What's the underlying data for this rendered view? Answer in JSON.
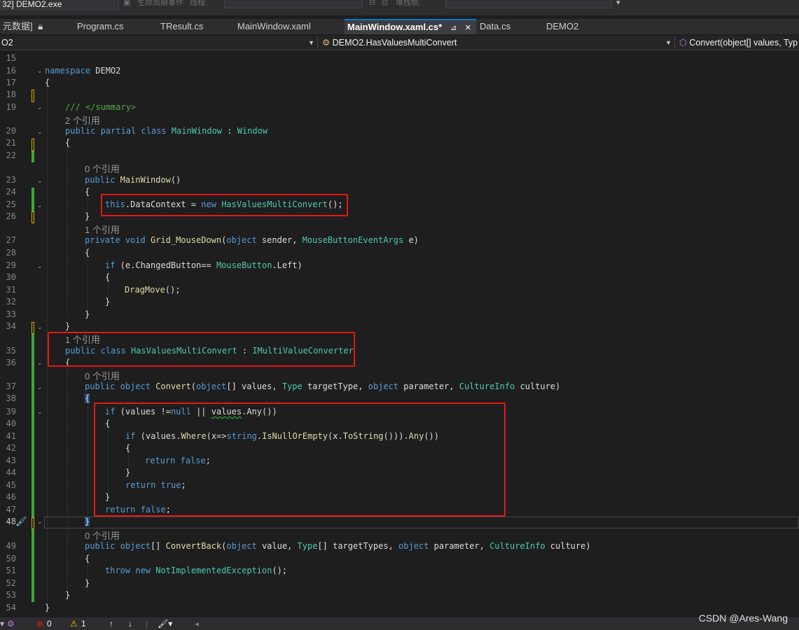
{
  "toolbar": {
    "process": "32] DEMO2.exe",
    "lifecycle_label": "生命周期事件",
    "thread_label": "线程:",
    "stack_label": "堆栈帧:"
  },
  "tabs": [
    {
      "label": "元数据]",
      "icon": "lock-icon"
    },
    {
      "label": "Program.cs"
    },
    {
      "label": "TResult.cs"
    },
    {
      "label": "MainWindow.xaml"
    },
    {
      "label": "MainWindow.xaml.cs*",
      "active": true,
      "pin": "⊿",
      "close": "✕"
    },
    {
      "label": "Data.cs"
    },
    {
      "label": "DEMO2"
    }
  ],
  "nav": {
    "project": "O2",
    "type": "DEMO2.HasValuesMultiConvert",
    "member": "Convert(object[] values, Typ"
  },
  "lines": [
    "15",
    "16",
    "17",
    "18",
    "19",
    "",
    "20",
    "21",
    "22",
    "",
    "23",
    "24",
    "25",
    "26",
    "",
    "27",
    "28",
    "29",
    "30",
    "31",
    "32",
    "33",
    "34",
    "",
    "35",
    "36",
    "",
    "37",
    "38",
    "39",
    "40",
    "41",
    "42",
    "43",
    "44",
    "45",
    "46",
    "47",
    "48",
    "",
    "49",
    "50",
    "51",
    "52",
    "53",
    "54"
  ],
  "code": {
    "ns_kw": "namespace",
    "ns_name": "DEMO2",
    "open_brace": "{",
    "close_brace": "}",
    "summary": "/// </summary>",
    "public": "public",
    "partial": "partial",
    "class": "class",
    "private": "private",
    "void": "void",
    "object": "object",
    "new": "new",
    "this": "this",
    "if": "if",
    "return": "return",
    "throw": "throw",
    "null": "null",
    "false": "false",
    "true": "true",
    "string": "string",
    "main_window": "MainWindow",
    "colon": ":",
    "window": "Window",
    "ctor_parens": "()",
    "data_context": ".DataContext = ",
    "has_values": "HasValuesMultiConvert",
    "ctor_end": "();",
    "grid_mousedown": "Grid_MouseDown",
    "paren_open": "(",
    "sender": " sender, ",
    "mouse_args": "MouseButtonEventArgs",
    "e_end": " e)",
    "changed_button": " (e.ChangedButton== ",
    "mouse_button": "MouseButton",
    "left_end": ".Left)",
    "drag_move": "DragMove",
    "call_end": "();",
    "imvc": "IMultiValueConverter",
    "convert": "Convert",
    "object_arr": "object",
    "values_param": "[] values, ",
    "type_type": "Type",
    "target_type": " targetType, ",
    "parameter": " parameter, ",
    "culture_info": "CultureInfo",
    "culture": " culture)",
    "values_check": " (values !=",
    "or_values": " || ",
    "values_word": "values",
    "any_call": ".Any())",
    "where_start": " (values.",
    "where": "Where",
    "lambda": "(x=>",
    "is_null_or_empty": ".IsNullOrEmpty",
    "to_string_part": "(x.",
    "to_string": "ToString",
    "where_end": "())).",
    "any": "Any",
    "any_end": "())",
    "semicolon": ";",
    "convert_back": "ConvertBack",
    "value_param": " value, ",
    "type_arr": "Type",
    "target_types": "[] targetTypes, ",
    "not_impl": "NotImplementedException",
    "throw_end": "();"
  },
  "refs": {
    "r2": "2 个引用",
    "r0a": "0 个引用",
    "r1a": "1 个引用",
    "r1b": "1 个引用",
    "r0b": "0 个引用",
    "r0c": "0 个引用"
  },
  "status": {
    "errors": "0",
    "warnings": "1"
  },
  "watermark": "CSDN @Ares-Wang",
  "colors": {
    "keyword": "#569cd6",
    "type": "#4ec9b0",
    "method": "#dcdcaa",
    "comment": "#57a64a",
    "highlight": "#e51717",
    "gutter_green": "#3ea53e",
    "gutter_yellow": "#c8b400"
  }
}
